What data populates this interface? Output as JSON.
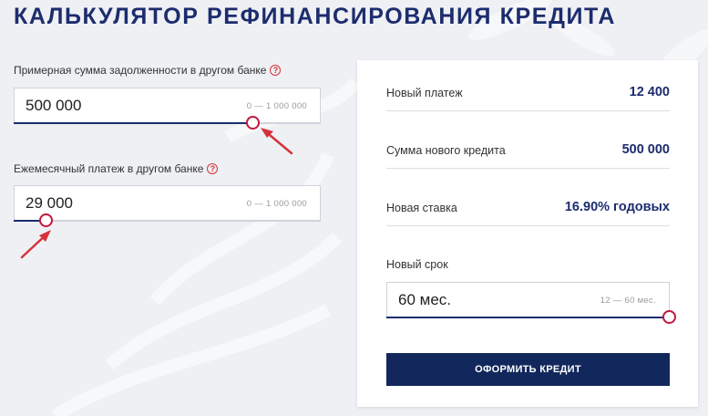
{
  "title": "КАЛЬКУЛЯТОР РЕФИНАНСИРОВАНИЯ КРЕДИТА",
  "debt": {
    "label": "Примерная сумма задолженности в другом банке",
    "value": "500 000 ",
    "range": "0 — 1 000 000 ",
    "fraction": 0.78
  },
  "payment": {
    "label": "Ежемесячный платеж в другом банке",
    "value": "29 000 ",
    "range": "0 — 1 000 000 ",
    "fraction": 0.1
  },
  "results": {
    "new_payment_label": "Новый платеж",
    "new_payment_value": "12 400 ",
    "new_credit_label": "Сумма нового кредита",
    "new_credit_value": "500 000 ",
    "new_rate_label": "Новая ставка",
    "new_rate_value": "16.90% годовых",
    "new_term_label": "Новый срок"
  },
  "term": {
    "value": "60 мес.",
    "range": "12 — 60 мес.",
    "fraction": 1.0
  },
  "apply_label": "ОФОРМИТЬ КРЕДИТ",
  "help_glyph": "?",
  "colors": {
    "brand": "#1c2c6e",
    "button": "#12285c",
    "accent_red": "#c2163d"
  }
}
